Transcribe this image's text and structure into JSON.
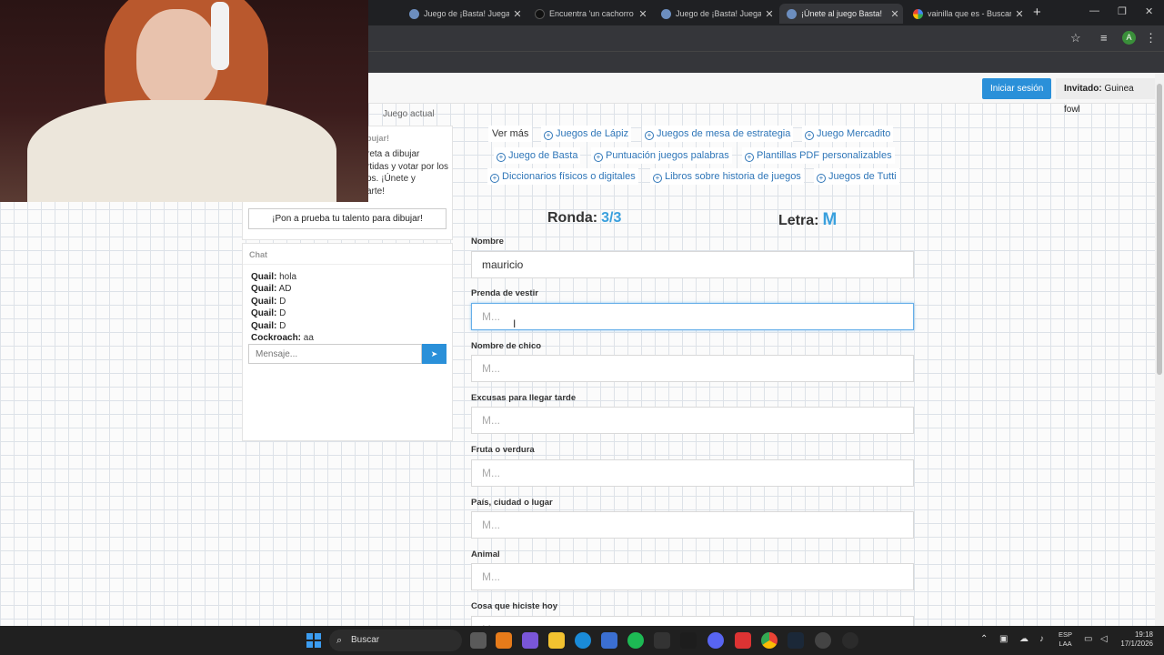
{
  "browser": {
    "tabs": [
      {
        "title": "Juego de ¡Basta! Juega St",
        "icon": "site-icon"
      },
      {
        "title": "Encuentra 'un cachorro fe",
        "icon": "tiktok-icon"
      },
      {
        "title": "Juego de ¡Basta! Juega St",
        "icon": "site-icon"
      },
      {
        "title": "¡Únete al juego Basta!",
        "icon": "site-icon",
        "active": true
      },
      {
        "title": "vainilla que es - Buscar c",
        "icon": "google-icon"
      }
    ],
    "new_tab": "+",
    "profile_initial": "A"
  },
  "header": {
    "login_button": "Iniciar sesión",
    "guest_label": "Invitado:",
    "guest_name": "Guinea fowl"
  },
  "breadcrumb": {
    "current": "Juego actual"
  },
  "join_panel": {
    "heading": "bujar!",
    "text_lines": [
      "reta a dibujar",
      "rtidas y votar por los",
      "os. ¡Únete y",
      "arte!"
    ],
    "button": "¡Pon a prueba tu talento para dibujar!"
  },
  "chat": {
    "title": "Chat",
    "messages": [
      {
        "user": "Quail:",
        "text": "hola"
      },
      {
        "user": "Quail:",
        "text": "AD"
      },
      {
        "user": "Quail:",
        "text": "D"
      },
      {
        "user": "Quail:",
        "text": "D"
      },
      {
        "user": "Quail:",
        "text": "D"
      },
      {
        "user": "Cockroach:",
        "text": "aa"
      }
    ],
    "input_placeholder": "Mensaje..."
  },
  "tags": {
    "ver_mas": "Ver más",
    "items": [
      "Juegos de Lápiz",
      "Juegos de mesa de estrategia",
      "Juego Mercadito",
      "Juego de Basta",
      "Puntuación juegos palabras",
      "Plantillas PDF personalizables",
      "Diccionarios físicos o digitales",
      "Libros sobre historia de juegos",
      "Juegos de Tutti"
    ]
  },
  "game": {
    "round_label": "Ronda:",
    "round_value": "3/3",
    "letter_label": "Letra:",
    "letter_value": "M",
    "placeholder": "M...",
    "fields": [
      {
        "label": "Nombre",
        "value": "mauricio"
      },
      {
        "label": "Prenda de vestir",
        "value": ""
      },
      {
        "label": "Nombre de chico",
        "value": ""
      },
      {
        "label": "Excusas para llegar tarde",
        "value": ""
      },
      {
        "label": "Fruta o verdura",
        "value": ""
      },
      {
        "label": "País, ciudad o lugar",
        "value": ""
      },
      {
        "label": "Animal",
        "value": ""
      },
      {
        "label": "Cosa que hiciste hoy",
        "value": ""
      }
    ]
  },
  "taskbar": {
    "search_label": "Buscar",
    "lang_line1": "ESP",
    "lang_line2": "LAA",
    "time": "19:18",
    "date": "17/1/2026"
  },
  "colors": {
    "accent": "#2a90d9",
    "tag_link": "#2f76b8",
    "round_value": "#3aa0dd"
  }
}
